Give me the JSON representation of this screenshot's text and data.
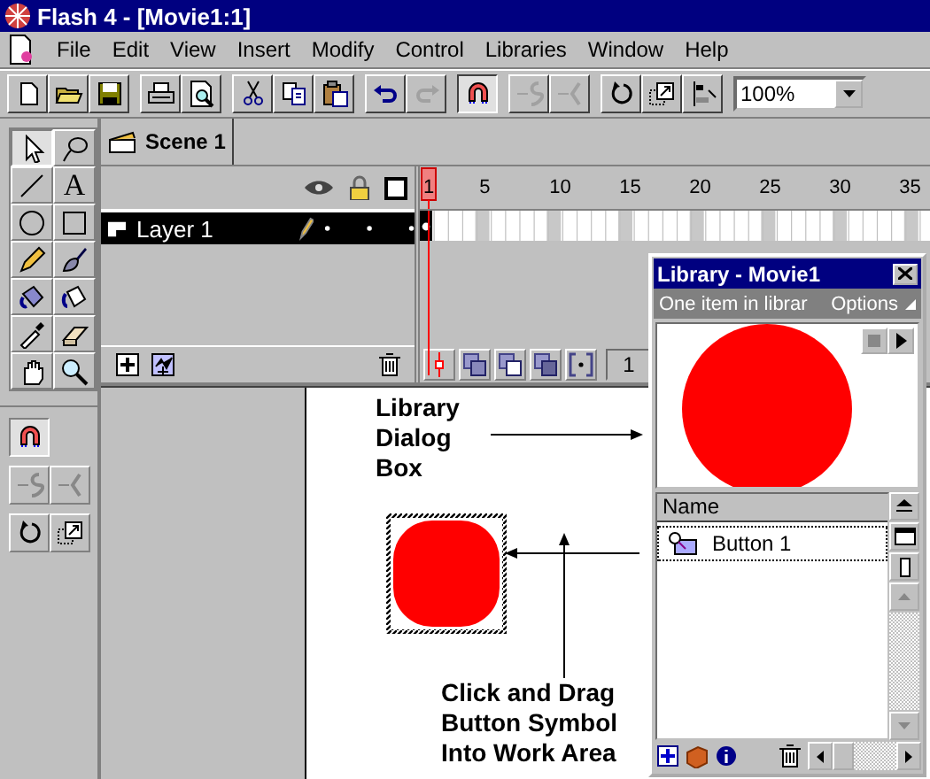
{
  "window": {
    "title": "Flash 4 - [Movie1:1]"
  },
  "menu": [
    "File",
    "Edit",
    "View",
    "Insert",
    "Modify",
    "Control",
    "Libraries",
    "Window",
    "Help"
  ],
  "toolbar": {
    "groups": [
      [
        {
          "kind": "new",
          "disabled": false
        },
        {
          "kind": "open",
          "disabled": false
        },
        {
          "kind": "save",
          "disabled": false
        }
      ],
      [
        {
          "kind": "print",
          "disabled": false
        },
        {
          "kind": "preview",
          "disabled": false
        }
      ],
      [
        {
          "kind": "cut",
          "disabled": false
        },
        {
          "kind": "copy",
          "disabled": false
        },
        {
          "kind": "paste",
          "disabled": false
        }
      ],
      [
        {
          "kind": "undo",
          "disabled": false
        },
        {
          "kind": "redo",
          "disabled": true
        }
      ],
      [
        {
          "kind": "snap",
          "disabled": false,
          "on": true
        }
      ],
      [
        {
          "kind": "smooth",
          "disabled": true
        },
        {
          "kind": "straighten",
          "disabled": true
        }
      ],
      [
        {
          "kind": "rotate",
          "disabled": false
        },
        {
          "kind": "scale",
          "disabled": false
        },
        {
          "kind": "align",
          "disabled": false
        }
      ]
    ],
    "zoom": "100%"
  },
  "tools": [
    {
      "kind": "arrow",
      "selected": true
    },
    {
      "kind": "lasso",
      "selected": false
    },
    {
      "kind": "line",
      "selected": false
    },
    {
      "kind": "text",
      "glyph": "A",
      "selected": false
    },
    {
      "kind": "oval",
      "selected": false
    },
    {
      "kind": "rect",
      "selected": false
    },
    {
      "kind": "pencil",
      "selected": false
    },
    {
      "kind": "brush",
      "selected": false
    },
    {
      "kind": "ink",
      "selected": false
    },
    {
      "kind": "bucket",
      "selected": false
    },
    {
      "kind": "dropper",
      "selected": false
    },
    {
      "kind": "eraser",
      "selected": false
    },
    {
      "kind": "hand",
      "selected": false
    },
    {
      "kind": "zoom",
      "selected": false
    }
  ],
  "options": [
    [
      {
        "kind": "snap",
        "on": true
      }
    ],
    [
      {
        "kind": "smooth",
        "on": false
      },
      {
        "kind": "straighten",
        "on": false
      }
    ],
    [
      {
        "kind": "rotate",
        "on": false
      },
      {
        "kind": "scale",
        "on": false
      }
    ]
  ],
  "scene": {
    "label": "Scene 1"
  },
  "timeline": {
    "layers": [
      {
        "name": "Layer 1",
        "selected": true
      }
    ],
    "ruler": [
      "1",
      "5",
      "10",
      "15",
      "20",
      "25",
      "30",
      "35"
    ],
    "current_frame": "1"
  },
  "stage": {
    "callouts": [
      {
        "lines": [
          "Library",
          "Dialog",
          "Box"
        ]
      },
      {
        "lines": [
          "Click and Drag",
          "Button Symbol",
          "Into Work Area"
        ]
      }
    ]
  },
  "library": {
    "title": "Library - Movie1",
    "status": "One item in librar",
    "options": "Options",
    "column": "Name",
    "items": [
      {
        "name": "Button 1",
        "selected": true
      }
    ]
  }
}
